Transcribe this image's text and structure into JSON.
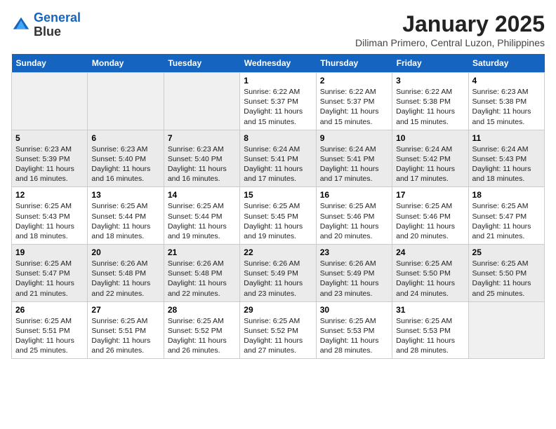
{
  "header": {
    "logo_line1": "General",
    "logo_line2": "Blue",
    "title": "January 2025",
    "subtitle": "Diliman Primero, Central Luzon, Philippines"
  },
  "weekdays": [
    "Sunday",
    "Monday",
    "Tuesday",
    "Wednesday",
    "Thursday",
    "Friday",
    "Saturday"
  ],
  "weeks": [
    [
      {
        "day": "",
        "info": ""
      },
      {
        "day": "",
        "info": ""
      },
      {
        "day": "",
        "info": ""
      },
      {
        "day": "1",
        "info": "Sunrise: 6:22 AM\nSunset: 5:37 PM\nDaylight: 11 hours\nand 15 minutes."
      },
      {
        "day": "2",
        "info": "Sunrise: 6:22 AM\nSunset: 5:37 PM\nDaylight: 11 hours\nand 15 minutes."
      },
      {
        "day": "3",
        "info": "Sunrise: 6:22 AM\nSunset: 5:38 PM\nDaylight: 11 hours\nand 15 minutes."
      },
      {
        "day": "4",
        "info": "Sunrise: 6:23 AM\nSunset: 5:38 PM\nDaylight: 11 hours\nand 15 minutes."
      }
    ],
    [
      {
        "day": "5",
        "info": "Sunrise: 6:23 AM\nSunset: 5:39 PM\nDaylight: 11 hours\nand 16 minutes."
      },
      {
        "day": "6",
        "info": "Sunrise: 6:23 AM\nSunset: 5:40 PM\nDaylight: 11 hours\nand 16 minutes."
      },
      {
        "day": "7",
        "info": "Sunrise: 6:23 AM\nSunset: 5:40 PM\nDaylight: 11 hours\nand 16 minutes."
      },
      {
        "day": "8",
        "info": "Sunrise: 6:24 AM\nSunset: 5:41 PM\nDaylight: 11 hours\nand 17 minutes."
      },
      {
        "day": "9",
        "info": "Sunrise: 6:24 AM\nSunset: 5:41 PM\nDaylight: 11 hours\nand 17 minutes."
      },
      {
        "day": "10",
        "info": "Sunrise: 6:24 AM\nSunset: 5:42 PM\nDaylight: 11 hours\nand 17 minutes."
      },
      {
        "day": "11",
        "info": "Sunrise: 6:24 AM\nSunset: 5:43 PM\nDaylight: 11 hours\nand 18 minutes."
      }
    ],
    [
      {
        "day": "12",
        "info": "Sunrise: 6:25 AM\nSunset: 5:43 PM\nDaylight: 11 hours\nand 18 minutes."
      },
      {
        "day": "13",
        "info": "Sunrise: 6:25 AM\nSunset: 5:44 PM\nDaylight: 11 hours\nand 18 minutes."
      },
      {
        "day": "14",
        "info": "Sunrise: 6:25 AM\nSunset: 5:44 PM\nDaylight: 11 hours\nand 19 minutes."
      },
      {
        "day": "15",
        "info": "Sunrise: 6:25 AM\nSunset: 5:45 PM\nDaylight: 11 hours\nand 19 minutes."
      },
      {
        "day": "16",
        "info": "Sunrise: 6:25 AM\nSunset: 5:46 PM\nDaylight: 11 hours\nand 20 minutes."
      },
      {
        "day": "17",
        "info": "Sunrise: 6:25 AM\nSunset: 5:46 PM\nDaylight: 11 hours\nand 20 minutes."
      },
      {
        "day": "18",
        "info": "Sunrise: 6:25 AM\nSunset: 5:47 PM\nDaylight: 11 hours\nand 21 minutes."
      }
    ],
    [
      {
        "day": "19",
        "info": "Sunrise: 6:25 AM\nSunset: 5:47 PM\nDaylight: 11 hours\nand 21 minutes."
      },
      {
        "day": "20",
        "info": "Sunrise: 6:26 AM\nSunset: 5:48 PM\nDaylight: 11 hours\nand 22 minutes."
      },
      {
        "day": "21",
        "info": "Sunrise: 6:26 AM\nSunset: 5:48 PM\nDaylight: 11 hours\nand 22 minutes."
      },
      {
        "day": "22",
        "info": "Sunrise: 6:26 AM\nSunset: 5:49 PM\nDaylight: 11 hours\nand 23 minutes."
      },
      {
        "day": "23",
        "info": "Sunrise: 6:26 AM\nSunset: 5:49 PM\nDaylight: 11 hours\nand 23 minutes."
      },
      {
        "day": "24",
        "info": "Sunrise: 6:25 AM\nSunset: 5:50 PM\nDaylight: 11 hours\nand 24 minutes."
      },
      {
        "day": "25",
        "info": "Sunrise: 6:25 AM\nSunset: 5:50 PM\nDaylight: 11 hours\nand 25 minutes."
      }
    ],
    [
      {
        "day": "26",
        "info": "Sunrise: 6:25 AM\nSunset: 5:51 PM\nDaylight: 11 hours\nand 25 minutes."
      },
      {
        "day": "27",
        "info": "Sunrise: 6:25 AM\nSunset: 5:51 PM\nDaylight: 11 hours\nand 26 minutes."
      },
      {
        "day": "28",
        "info": "Sunrise: 6:25 AM\nSunset: 5:52 PM\nDaylight: 11 hours\nand 26 minutes."
      },
      {
        "day": "29",
        "info": "Sunrise: 6:25 AM\nSunset: 5:52 PM\nDaylight: 11 hours\nand 27 minutes."
      },
      {
        "day": "30",
        "info": "Sunrise: 6:25 AM\nSunset: 5:53 PM\nDaylight: 11 hours\nand 28 minutes."
      },
      {
        "day": "31",
        "info": "Sunrise: 6:25 AM\nSunset: 5:53 PM\nDaylight: 11 hours\nand 28 minutes."
      },
      {
        "day": "",
        "info": ""
      }
    ]
  ]
}
